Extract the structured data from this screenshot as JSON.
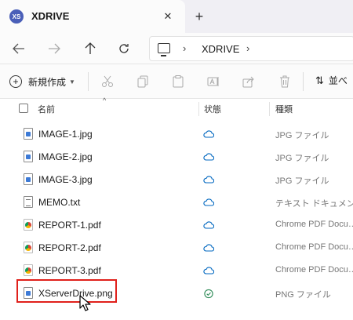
{
  "tab": {
    "icon_text": "XS",
    "title": "XDRIVE",
    "close": "✕",
    "new": "+"
  },
  "nav": {
    "back_icon": "arrow-left-icon",
    "forward_icon": "arrow-right-icon",
    "up_icon": "arrow-up-icon",
    "refresh_icon": "refresh-icon",
    "breadcrumb_sep": "›",
    "location": "XDRIVE"
  },
  "toolbar": {
    "new_label": "新規作成",
    "sort_label": "並べ",
    "icons": [
      "cut-icon",
      "copy-icon",
      "paste-icon",
      "rename-icon",
      "share-icon",
      "delete-icon"
    ]
  },
  "columns": {
    "name": "名前",
    "status": "状態",
    "type": "種類"
  },
  "files": [
    {
      "name": "IMAGE-1.jpg",
      "kind": "img",
      "status": "cloud",
      "type": "JPG ファイル"
    },
    {
      "name": "IMAGE-2.jpg",
      "kind": "img",
      "status": "cloud",
      "type": "JPG ファイル"
    },
    {
      "name": "IMAGE-3.jpg",
      "kind": "img",
      "status": "cloud",
      "type": "JPG ファイル"
    },
    {
      "name": "MEMO.txt",
      "kind": "txt",
      "status": "cloud",
      "type": "テキスト ドキュメント"
    },
    {
      "name": "REPORT-1.pdf",
      "kind": "pdf",
      "status": "cloud",
      "type": "Chrome PDF Docu…"
    },
    {
      "name": "REPORT-2.pdf",
      "kind": "pdf",
      "status": "cloud",
      "type": "Chrome PDF Docu…"
    },
    {
      "name": "REPORT-3.pdf",
      "kind": "pdf",
      "status": "cloud",
      "type": "Chrome PDF Docu…"
    },
    {
      "name": "XServerDrive.png",
      "kind": "img",
      "status": "synced",
      "type": "PNG ファイル"
    }
  ],
  "colors": {
    "accent": "#0067c0",
    "synced": "#2e8b57",
    "highlight": "#e0201b"
  }
}
